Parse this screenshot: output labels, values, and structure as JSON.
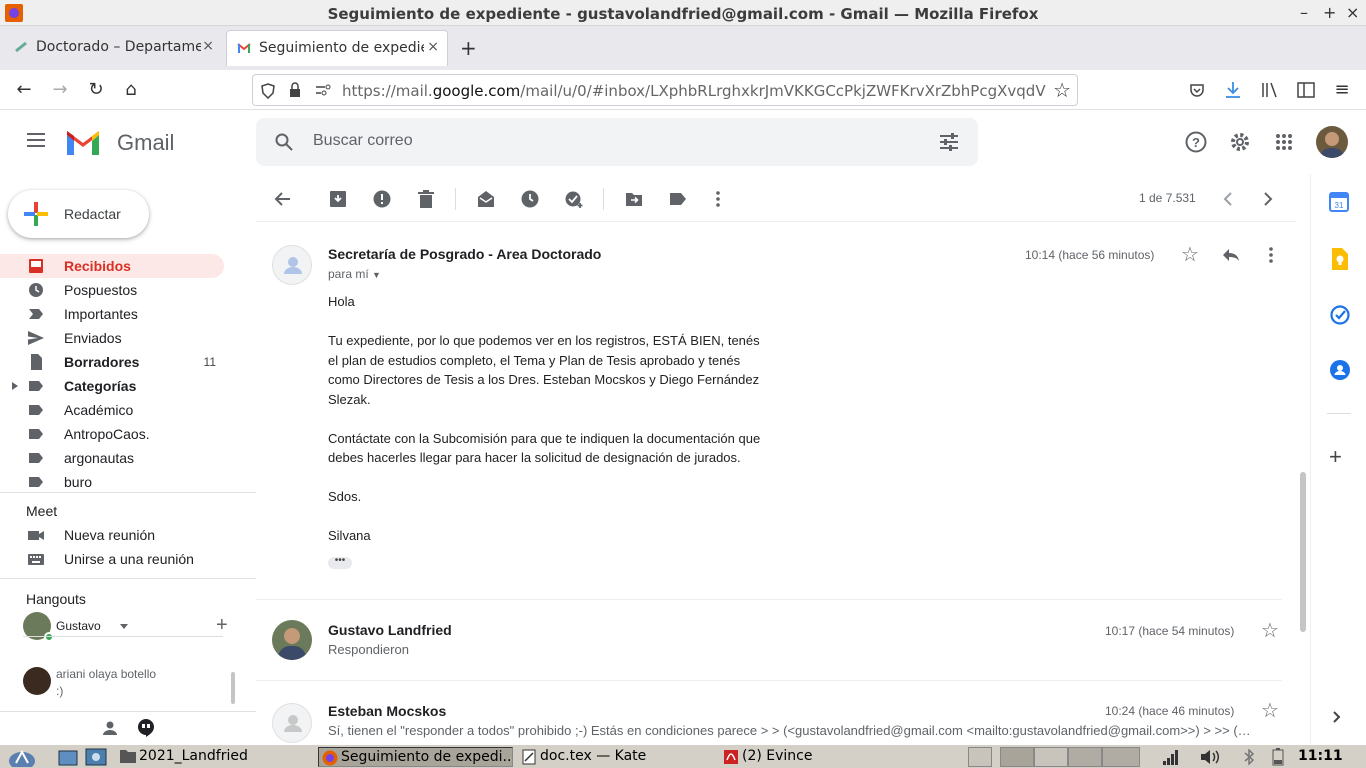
{
  "window": {
    "title": "Seguimiento de expediente - gustavolandfried@gmail.com - Gmail — Mozilla Firefox"
  },
  "tabs": [
    {
      "label": "Doctorado – Departamen"
    },
    {
      "label": "Seguimiento de expedien"
    }
  ],
  "url": {
    "prefix": "https://mail.",
    "domain": "google.com",
    "path": "/mail/u/0/#inbox/LXphbRLrghxkrJmVKKGCcPkjZWFKrvXrZbhPcgXvqdV"
  },
  "gmail": {
    "app_name": "Gmail",
    "search_placeholder": "Buscar correo",
    "compose": "Redactar",
    "nav": [
      {
        "label": "Recibidos",
        "count": ""
      },
      {
        "label": "Pospuestos",
        "count": ""
      },
      {
        "label": "Importantes",
        "count": ""
      },
      {
        "label": "Enviados",
        "count": ""
      },
      {
        "label": "Borradores",
        "count": "11"
      },
      {
        "label": "Categorías",
        "count": ""
      },
      {
        "label": "Académico",
        "count": ""
      },
      {
        "label": "AntropoCaos.",
        "count": ""
      },
      {
        "label": "argonautas",
        "count": ""
      },
      {
        "label": "buro",
        "count": ""
      }
    ],
    "meet": {
      "title": "Meet",
      "new_meeting": "Nueva reunión",
      "join": "Unirse a una reunión"
    },
    "hangouts": {
      "title": "Hangouts",
      "user": "Gustavo",
      "contact_name": "ariani olaya botello",
      "contact_msg": ":)"
    },
    "pagination": "1 de 7.531",
    "messages": [
      {
        "sender": "Secretaría de Posgrado - Area Doctorado",
        "recipient": "para mí",
        "time": "10:14 (hace 56 minutos)",
        "body": [
          "Hola",
          "Tu expediente, por lo que podemos ver en los registros, ESTÁ BIEN, tenés el plan de estudios completo, el Tema y Plan de Tesis aprobado y tenés como Directores de Tesis a los Dres. Esteban Mocskos y Diego Fernández Slezak.",
          "Contáctate con la Subcomisión para que te indiquen la documentación que debes hacerles llegar para hacer la solicitud de designación de jurados.",
          "Sdos.",
          "Silvana"
        ]
      },
      {
        "sender": "Gustavo Landfried",
        "snippet": "Respondieron",
        "time": "10:17 (hace 54 minutos)"
      },
      {
        "sender": "Esteban Mocskos",
        "snippet": "Sí, tienen el \"responder a todos\" prohibido ;-) Estás en condiciones parece > > (<gustavolandfried@gmail.com <mailto:gustavolandfried@gmail.com>>) > >> (…",
        "time": "10:24 (hace 46 minutos)"
      }
    ]
  },
  "taskbar": {
    "items": [
      "2021_Landfried",
      "Seguimiento de expedi...",
      "doc.tex — Kate",
      "(2) Evince"
    ],
    "clock": "11:11"
  },
  "colors": {
    "accent_red": "#d93025",
    "selected_bg": "#fce8e6",
    "blue": "#1a73e8"
  }
}
